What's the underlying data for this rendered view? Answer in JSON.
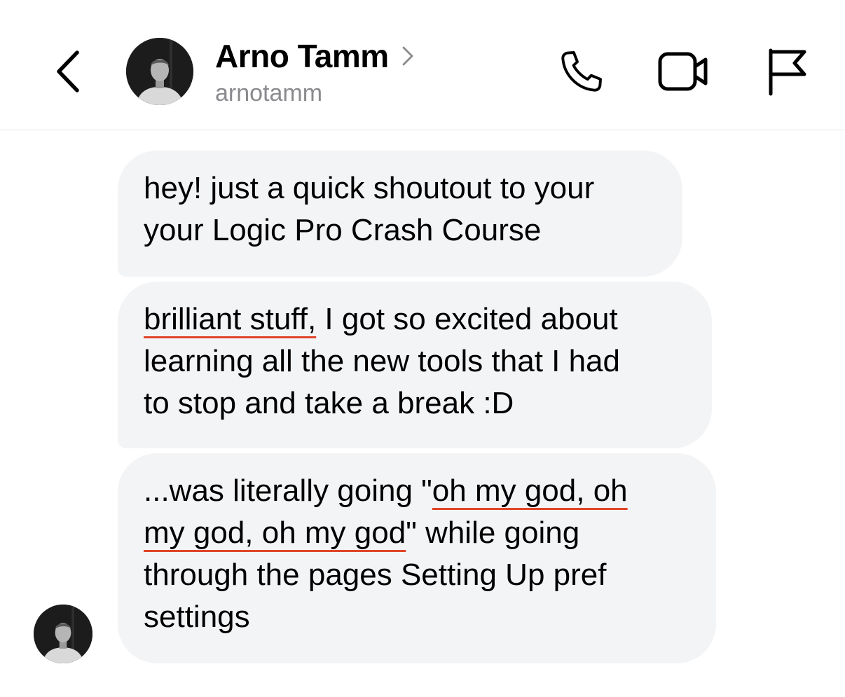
{
  "header": {
    "contact_name": "Arno Tamm",
    "username": "arnotamm",
    "icons": {
      "back": "chevron-left-icon",
      "profile": "chevron-right-icon",
      "call": "phone-icon",
      "video": "video-camera-icon",
      "report": "flag-icon"
    }
  },
  "messages": [
    {
      "lines": [
        "hey! just a quick shoutout to your",
        "your Logic Pro Crash Course"
      ]
    },
    {
      "lines": [
        {
          "underlined": "brilliant stuff,",
          "rest": " I got so excited about"
        },
        "learning all the new tools that I had",
        "to stop and take a break :D"
      ]
    },
    {
      "lines": [
        {
          "before": "...was literally going \"",
          "underlined": "oh my god, oh"
        },
        {
          "underlined": "my god, oh my god",
          "rest": "\" while going"
        },
        "through the pages Setting Up pref",
        "settings"
      ]
    }
  ],
  "colors": {
    "bubble_background": "#f3f4f6",
    "underline_accent": "#e0452b",
    "secondary_text": "#8a8a8e"
  }
}
